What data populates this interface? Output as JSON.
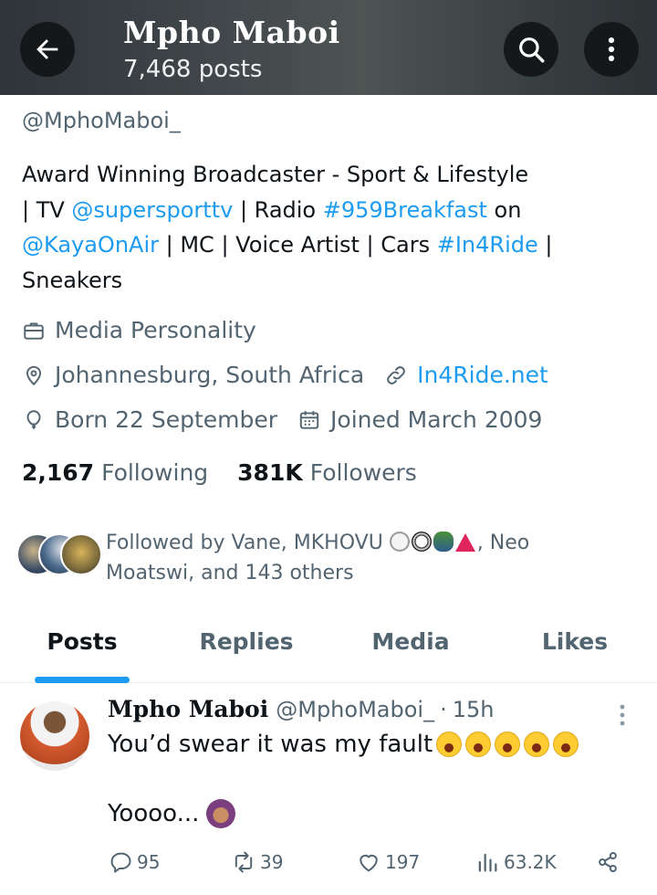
{
  "header": {
    "title": "Mpho Maboi",
    "post_count": "7,468 posts"
  },
  "profile": {
    "handle": "@MphoMaboi_",
    "bio": {
      "line1": "Award Winning Broadcaster - Sport & Lifestyle",
      "l2_a": "| TV ",
      "l2_link1": "@supersporttv",
      "l2_b": " | Radio ",
      "l2_link2": "#959Breakfast",
      "l2_c": " on",
      "l3_link1": "@KayaOnAir",
      "l3_a": " | MC | Voice Artist | Cars ",
      "l3_link2": "#In4Ride",
      "l3_b": " |",
      "line4": "Sneakers"
    },
    "category": "Media Personality",
    "location": "Johannesburg, South Africa",
    "website": "In4Ride.net",
    "birthday": "Born 22 September",
    "joined": "Joined March 2009",
    "following_count": "2,167",
    "following_label": "Following",
    "followers_count": "381K",
    "followers_label": "Followers",
    "followed_by_a": "Followed by Vane, MKHOVU ",
    "followed_by_b": ", Neo",
    "followed_by_c": "Moatswi, and 143 others"
  },
  "tabs": [
    {
      "label": "Posts",
      "active": true
    },
    {
      "label": "Replies",
      "active": false
    },
    {
      "label": "Media",
      "active": false
    },
    {
      "label": "Likes",
      "active": false
    }
  ],
  "tweet": {
    "name": "Mpho Maboi",
    "handle": "@MphoMaboi_",
    "separator": "·",
    "time": "15h",
    "text_line1": "You’d swear it was my fault",
    "text_line2": "Yoooo...",
    "replies": "95",
    "reposts": "39",
    "likes": "197",
    "views": "63.2K"
  },
  "colors": {
    "accent": "#1d9bf0",
    "text_primary": "#0f1419",
    "text_secondary": "#536471"
  },
  "icons": [
    "back-arrow-icon",
    "search-icon",
    "more-vertical-icon",
    "briefcase-icon",
    "location-pin-icon",
    "link-icon",
    "balloon-icon",
    "calendar-icon",
    "reply-icon",
    "repost-icon",
    "like-icon",
    "views-icon",
    "share-icon"
  ]
}
